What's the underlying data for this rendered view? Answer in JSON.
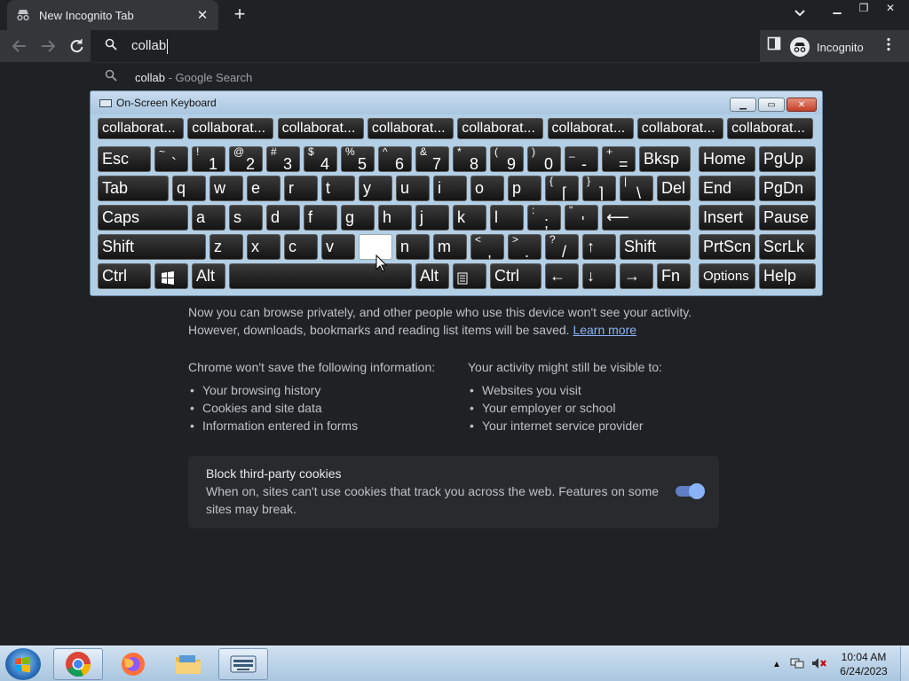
{
  "browser": {
    "tab_title": "New Incognito Tab",
    "omnibox_text": "collab",
    "suggestion_query": "collab",
    "suggestion_suffix": " - Google Search",
    "profile_label": "Incognito"
  },
  "osk": {
    "title": "On-Screen Keyboard",
    "predictions": [
      "collaborat...",
      "collaborat...",
      "collaborat...",
      "collaborat...",
      "collaborat...",
      "collaborat...",
      "collaborat...",
      "collaborat..."
    ],
    "keys": {
      "esc": "Esc",
      "bksp": "Bksp",
      "home": "Home",
      "pgup": "PgUp",
      "tab": "Tab",
      "del": "Del",
      "end": "End",
      "pgdn": "PgDn",
      "caps": "Caps",
      "insert": "Insert",
      "pause": "Pause",
      "shift": "Shift",
      "prtscn": "PrtScn",
      "scrlk": "ScrLk",
      "ctrl": "Ctrl",
      "alt": "Alt",
      "fn": "Fn",
      "options": "Options",
      "help": "Help",
      "q": "q",
      "w": "w",
      "e": "e",
      "r": "r",
      "t": "t",
      "y": "y",
      "u": "u",
      "i": "i",
      "o": "o",
      "p": "p",
      "a": "a",
      "s": "s",
      "d": "d",
      "f": "f",
      "g": "g",
      "h": "h",
      "j": "j",
      "k": "k",
      "l": "l",
      "z": "z",
      "x": "x",
      "c": "c",
      "v": "v",
      "n": "n",
      "m": "m",
      "tilde_top": "~",
      "tilde_bot": "`",
      "n1_top": "!",
      "n1": "1",
      "n2_top": "@",
      "n2": "2",
      "n3_top": "#",
      "n3": "3",
      "n4_top": "$",
      "n4": "4",
      "n5_top": "%",
      "n5": "5",
      "n6_top": "^",
      "n6": "6",
      "n7_top": "&",
      "n7": "7",
      "n8_top": "*",
      "n8": "8",
      "n9_top": "(",
      "n9": "9",
      "n0_top": ")",
      "n0": "0",
      "minus_top": "_",
      "minus": "-",
      "eq_top": "+",
      "eq": "=",
      "lbr_top": "{",
      "lbr": "[",
      "rbr_top": "}",
      "rbr": "]",
      "bs_top": "|",
      "bs": "\\",
      "semi_top": ":",
      "semi": ";",
      "quote_top": "\"",
      "quote": "'",
      "comma_top": "<",
      "comma": ",",
      "period_top": ">",
      "period": ".",
      "slash_top": "?",
      "slash": "/",
      "up": "↑",
      "down": "↓",
      "left": "←",
      "right": "→",
      "enter": "⟵"
    }
  },
  "page": {
    "intro_line1": "Now you can browse privately, and other people who use this device won't see your activity.",
    "intro_line2": "However, downloads, bookmarks and reading list items will be saved.",
    "learn_more": "Learn more",
    "col1_title": "Chrome won't save the following information:",
    "col1_items": [
      "Your browsing history",
      "Cookies and site data",
      "Information entered in forms"
    ],
    "col2_title": "Your activity might still be visible to:",
    "col2_items": [
      "Websites you visit",
      "Your employer or school",
      "Your internet service provider"
    ],
    "cookie_title": "Block third-party cookies",
    "cookie_desc": "When on, sites can't use cookies that track you across the web. Features on some sites may break."
  },
  "taskbar": {
    "time": "10:04 AM",
    "date": "6/24/2023"
  },
  "colors": {
    "page_bg": "#202124",
    "toolbar_bg": "#35363a",
    "link": "#8ab4f8",
    "toggle_on": "#8ab4f8"
  }
}
